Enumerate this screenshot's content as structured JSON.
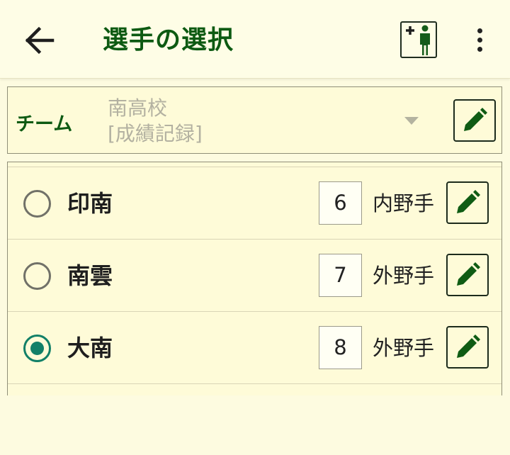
{
  "app_bar": {
    "title": "選手の選択",
    "back_icon": "arrow-left-icon",
    "add_player_icon": "add-person-icon",
    "more_icon": "more-vertical-icon"
  },
  "team": {
    "label": "チーム",
    "school": "南高校",
    "record_type": "[成績記録]",
    "edit_icon": "pencil-icon"
  },
  "players": [
    {
      "name": "印南",
      "number": "6",
      "position": "内野手",
      "selected": false
    },
    {
      "name": "南雲",
      "number": "7",
      "position": "外野手",
      "selected": false
    },
    {
      "name": "大南",
      "number": "8",
      "position": "外野手",
      "selected": true
    }
  ],
  "colors": {
    "accent_green": "#0d5a12",
    "radio_selected": "#128068",
    "background": "#fdfbe0"
  }
}
